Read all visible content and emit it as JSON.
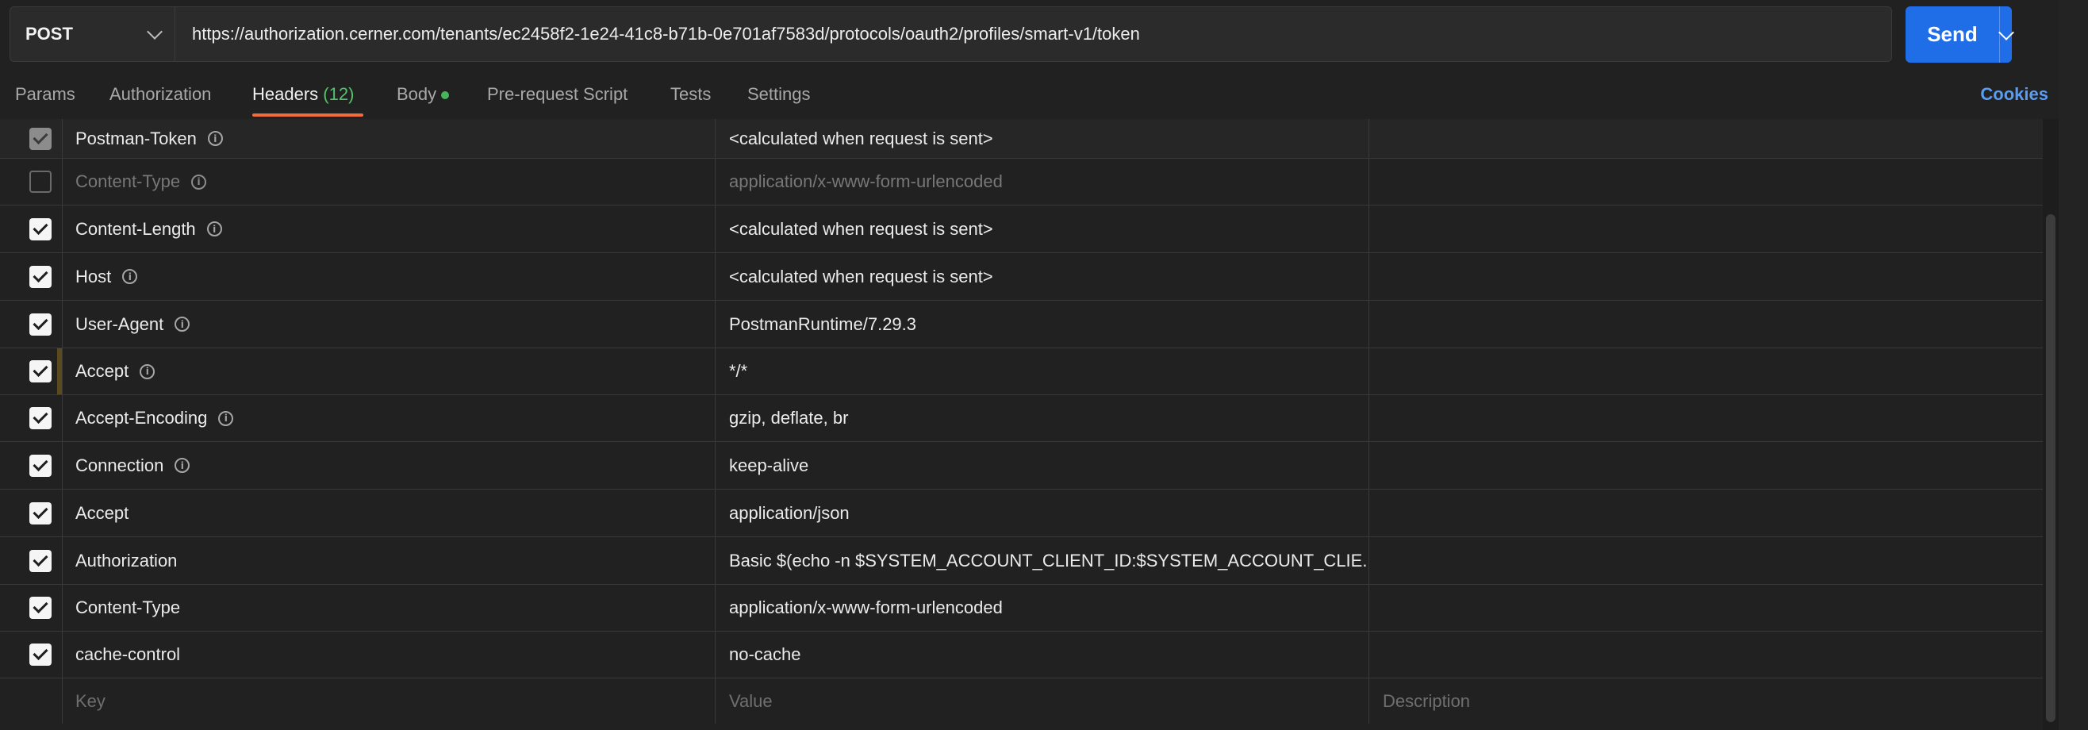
{
  "request": {
    "method": "POST",
    "url": "https://authorization.cerner.com/tenants/ec2458f2-1e24-41c8-b71b-0e701af7583d/protocols/oauth2/profiles/smart-v1/token",
    "send_label": "Send"
  },
  "tabs": {
    "params": "Params",
    "authorization": "Authorization",
    "headers": "Headers",
    "headers_count": "(12)",
    "body": "Body",
    "prerequest": "Pre-request Script",
    "tests": "Tests",
    "settings": "Settings",
    "cookies": "Cookies"
  },
  "headers": [
    {
      "key": "Postman-Token",
      "value": "<calculated when request is sent>",
      "state": "auto"
    },
    {
      "key": "Content-Type",
      "value": "application/x-www-form-urlencoded",
      "state": "off"
    },
    {
      "key": "Content-Length",
      "value": "<calculated when request is sent>",
      "state": "on"
    },
    {
      "key": "Host",
      "value": "<calculated when request is sent>",
      "state": "on"
    },
    {
      "key": "User-Agent",
      "value": "PostmanRuntime/7.29.3",
      "state": "on"
    },
    {
      "key": "Accept",
      "value": "*/*",
      "state": "on"
    },
    {
      "key": "Accept-Encoding",
      "value": "gzip, deflate, br",
      "state": "on"
    },
    {
      "key": "Connection",
      "value": "keep-alive",
      "state": "on"
    },
    {
      "key": "Accept",
      "value": "application/json",
      "state": "on"
    },
    {
      "key": "Authorization",
      "value": "Basic $(echo -n $SYSTEM_ACCOUNT_CLIENT_ID:$SYSTEM_ACCOUNT_CLIE...",
      "state": "on"
    },
    {
      "key": "Content-Type",
      "value": "application/x-www-form-urlencoded",
      "state": "on"
    },
    {
      "key": "cache-control",
      "value": "no-cache",
      "state": "on"
    }
  ],
  "new_row": {
    "key_placeholder": "Key",
    "value_placeholder": "Value",
    "description_placeholder": "Description"
  },
  "colors": {
    "send": "#1f6ee8",
    "active_tab_underline": "#f26b3a",
    "count": "#52c36a",
    "cookies": "#5b9cf3"
  }
}
